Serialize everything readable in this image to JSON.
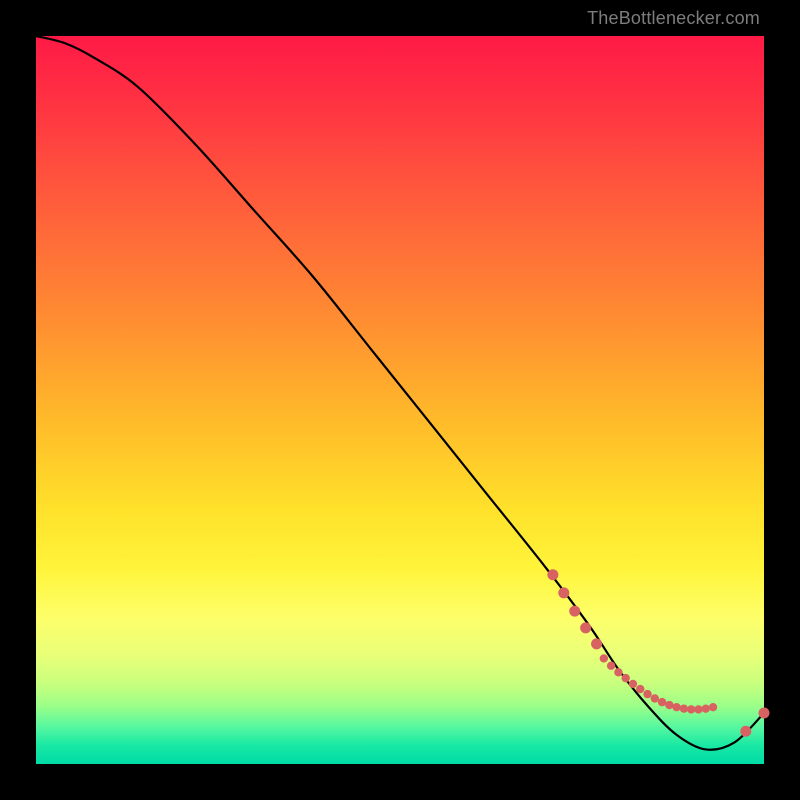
{
  "attribution": "TheBottlenecker.com",
  "chart_data": {
    "type": "line",
    "title": "",
    "xlabel": "",
    "ylabel": "",
    "xlim": [
      0,
      100
    ],
    "ylim": [
      0,
      100
    ],
    "series": [
      {
        "name": "curve",
        "x": [
          0,
          4,
          8,
          14,
          22,
          30,
          38,
          46,
          54,
          62,
          70,
          76,
          80,
          84,
          88,
          92,
          96,
          100
        ],
        "y": [
          100,
          99,
          97,
          93,
          85,
          76,
          67,
          57,
          47,
          37,
          27,
          19,
          13,
          8,
          4,
          2,
          3,
          7
        ]
      }
    ],
    "markers_dense": {
      "comment": "salmon dotted segment near trough, along curve",
      "x": [
        78,
        79,
        80,
        81,
        82,
        83,
        84,
        85,
        86,
        87,
        88,
        89,
        90,
        91,
        92,
        93
      ],
      "y": [
        14.5,
        13.5,
        12.6,
        11.8,
        11.0,
        10.3,
        9.6,
        9.0,
        8.5,
        8.1,
        7.8,
        7.6,
        7.5,
        7.5,
        7.6,
        7.8
      ]
    },
    "markers_sparse": {
      "comment": "sparse larger salmon dots on descending and rising parts",
      "points": [
        {
          "x": 71,
          "y": 26
        },
        {
          "x": 72.5,
          "y": 23.5
        },
        {
          "x": 74,
          "y": 21
        },
        {
          "x": 75.5,
          "y": 18.7
        },
        {
          "x": 77,
          "y": 16.5
        },
        {
          "x": 97.5,
          "y": 4.5
        },
        {
          "x": 100,
          "y": 7
        }
      ]
    },
    "colors": {
      "curve": "#000000",
      "marker": "#d86262"
    }
  }
}
